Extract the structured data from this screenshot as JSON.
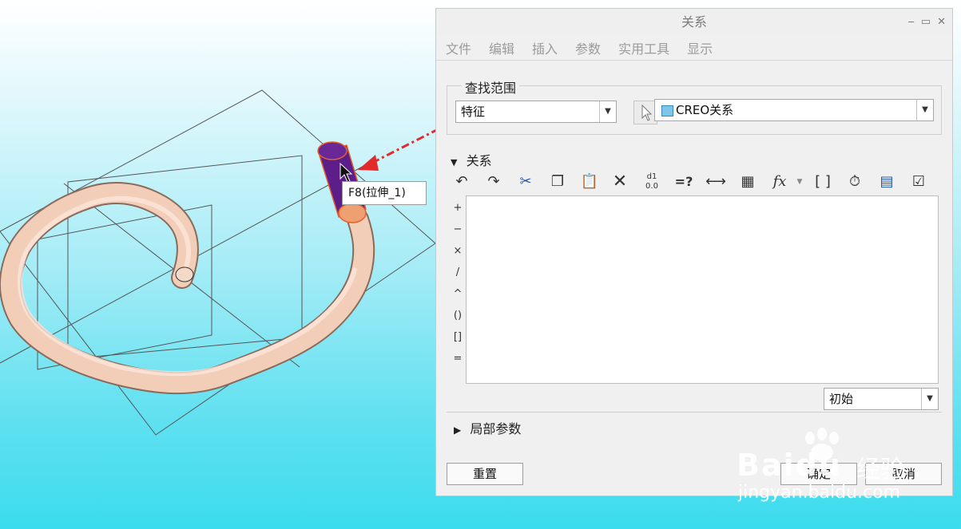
{
  "viewport": {
    "tooltip": "F8(拉伸_1)"
  },
  "dialog": {
    "title": "关系",
    "window_buttons": [
      "‒",
      "▭",
      "✕"
    ],
    "menu": [
      "文件",
      "编辑",
      "插入",
      "参数",
      "实用工具",
      "显示"
    ],
    "lookup": {
      "legend": "查找范围",
      "type_value": "特征",
      "target_value": "CREO关系"
    },
    "relations": {
      "section_label": "关系",
      "toolbar_icons": [
        "undo-icon",
        "redo-icon",
        "cut-icon",
        "copy-icon",
        "paste-icon",
        "delete-icon",
        "show-values-icon",
        "evaluate-icon",
        "dimension-icon",
        "sort-icon",
        "function-icon",
        "brackets-icon",
        "verify-icon",
        "insert-parameter-icon",
        "check-icon"
      ],
      "operators": [
        "+",
        "−",
        "×",
        "/",
        "^",
        "()",
        "[]",
        "="
      ],
      "editor_text": "",
      "mode_value": "初始"
    },
    "local_params_label": "局部参数",
    "buttons": {
      "reset": "重置",
      "ok": "确定",
      "cancel": "取消"
    }
  },
  "watermark": {
    "logo": "Baidu",
    "logo_cn": "经验",
    "url": "jingyan.baidu.com"
  },
  "colors": {
    "accent_red": "#e32b2b",
    "part_color": "#f2cdb8",
    "feature_highlight": "#5d1e8a"
  }
}
